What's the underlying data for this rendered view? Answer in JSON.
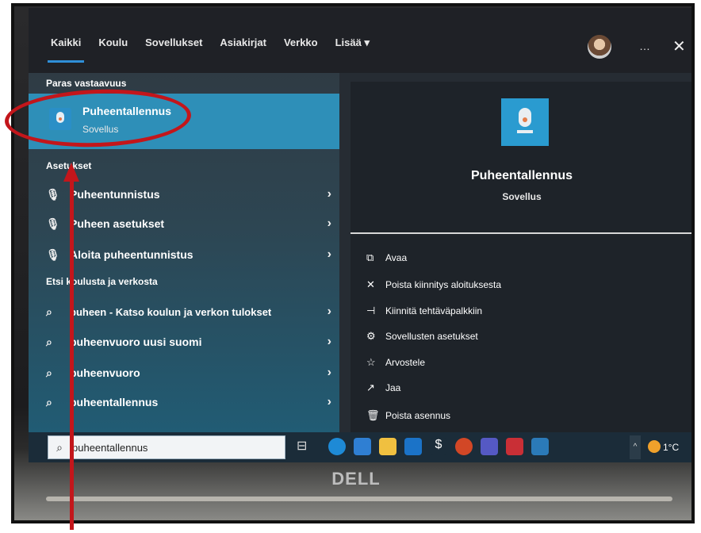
{
  "nav": {
    "tabs": [
      "Kaikki",
      "Koulu",
      "Sovellukset",
      "Asiakirjat",
      "Verkko",
      "Lisää ▾"
    ],
    "more_icon": "…",
    "close_icon": "✕"
  },
  "left": {
    "best_match_header": "Paras vastaavuus",
    "best_match": {
      "title": "Puheentallennus",
      "subtitle": "Sovellus"
    },
    "settings_header": "Asetukset",
    "settings": [
      {
        "label": "Puheentunnistus",
        "icon": "microphone-icon"
      },
      {
        "label": "Puheen asetukset",
        "icon": "microphone-icon"
      },
      {
        "label": "Aloita puheentunnistus",
        "icon": "microphone-icon"
      }
    ],
    "web_header": "Etsi koulusta ja verkosta",
    "web_results": [
      {
        "label": "puheen - Katso koulun ja verkon tulokset"
      },
      {
        "label": "puheenvuoro uusi suomi"
      },
      {
        "label": "puheenvuoro"
      },
      {
        "label": "puheentallennus"
      }
    ]
  },
  "right": {
    "title": "Puheentallennus",
    "subtitle": "Sovellus",
    "actions": [
      {
        "label": "Avaa",
        "icon": "open-icon"
      },
      {
        "label": "Poista kiinnitys aloituksesta",
        "icon": "unpin-icon"
      },
      {
        "label": "Kiinnitä tehtäväpalkkiin",
        "icon": "pin-icon"
      },
      {
        "label": "Sovellusten asetukset",
        "icon": "gear-icon"
      },
      {
        "label": "Arvostele",
        "icon": "star-icon"
      },
      {
        "label": "Jaa",
        "icon": "share-icon"
      },
      {
        "label": "Poista asennus",
        "icon": "trash-icon"
      }
    ]
  },
  "taskbar": {
    "search_value": "puheentallennus",
    "temperature": "1°C"
  },
  "brand": "DELL",
  "colors": {
    "annotation": "#c3161b",
    "accent": "#2f8fd8",
    "selected": "#2e8fb8"
  }
}
